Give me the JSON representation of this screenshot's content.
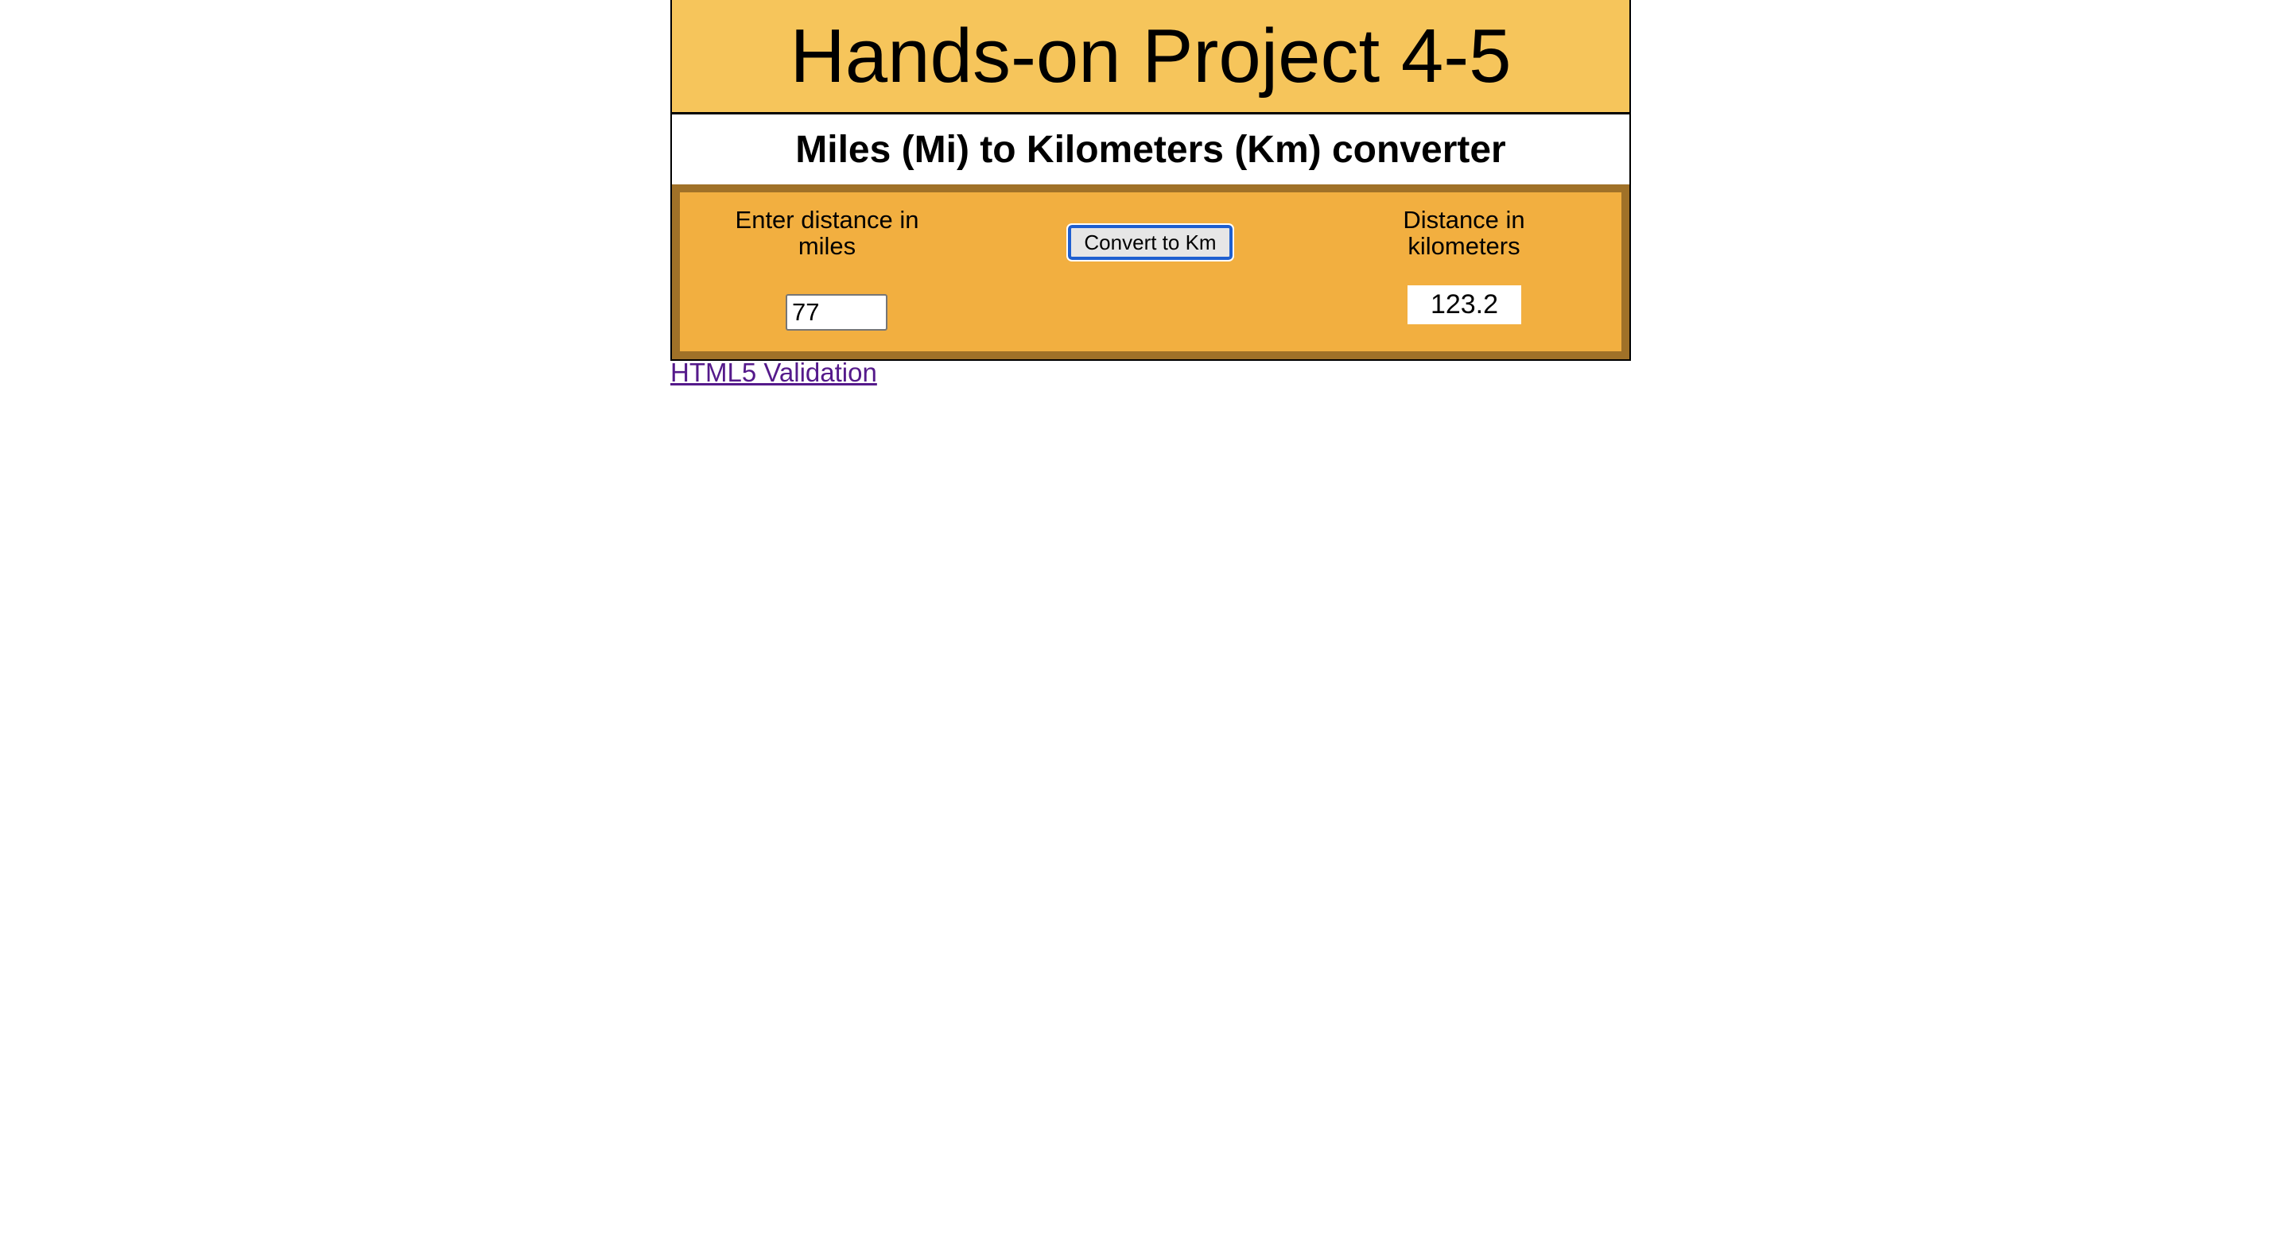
{
  "header": {
    "title": "Hands-on Project 4-5"
  },
  "subtitle": "Miles (Mi) to Kilometers (Km) converter",
  "form": {
    "miles_label": "Enter distance in miles",
    "miles_value": "77",
    "convert_label": "Convert to Km",
    "km_label": "Distance in kilometers",
    "km_value": "123.2"
  },
  "footer": {
    "validation_link": "HTML5 Validation"
  },
  "colors": {
    "header_bg": "#F6C55B",
    "form_bg": "#F2AF40",
    "form_border": "#A07128",
    "link": "#551A8B"
  }
}
